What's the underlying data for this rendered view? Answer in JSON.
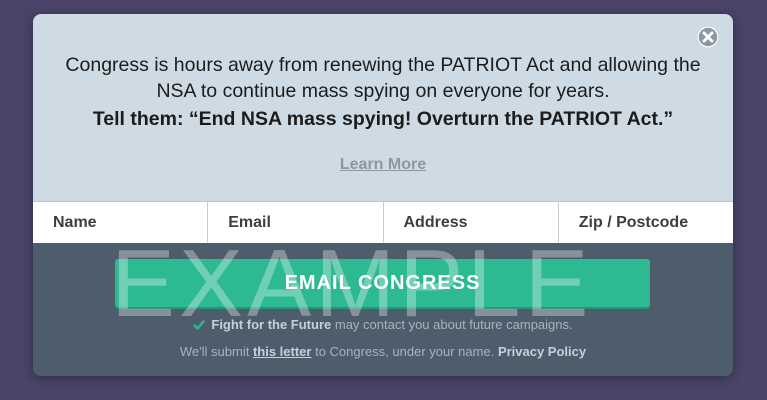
{
  "popup": {
    "message": "Congress is hours away from renewing the PATRIOT Act and allowing the NSA to continue mass spying on everyone for years.",
    "call_to_action": "Tell them: “End NSA mass spying! Overturn the PATRIOT Act.”",
    "learn_more": "Learn More",
    "close_icon": "close-icon"
  },
  "form": {
    "fields": [
      "Name",
      "Email",
      "Address",
      "Zip / Postcode"
    ],
    "submit_label": "EMAIL CONGRESS",
    "watermark": "EXAMPLE"
  },
  "consent": {
    "checked": true,
    "org_name": "Fight for the Future",
    "text": "may contact you about future campaigns."
  },
  "legal": {
    "prefix": "We'll submit",
    "letter_link": "this letter",
    "middle": "to Congress, under your name.",
    "privacy_link": "Privacy Policy"
  },
  "colors": {
    "background": "#494468",
    "panel_top": "#cfdbe4",
    "panel_bottom": "#4e5d6c",
    "accent": "#2db992"
  }
}
